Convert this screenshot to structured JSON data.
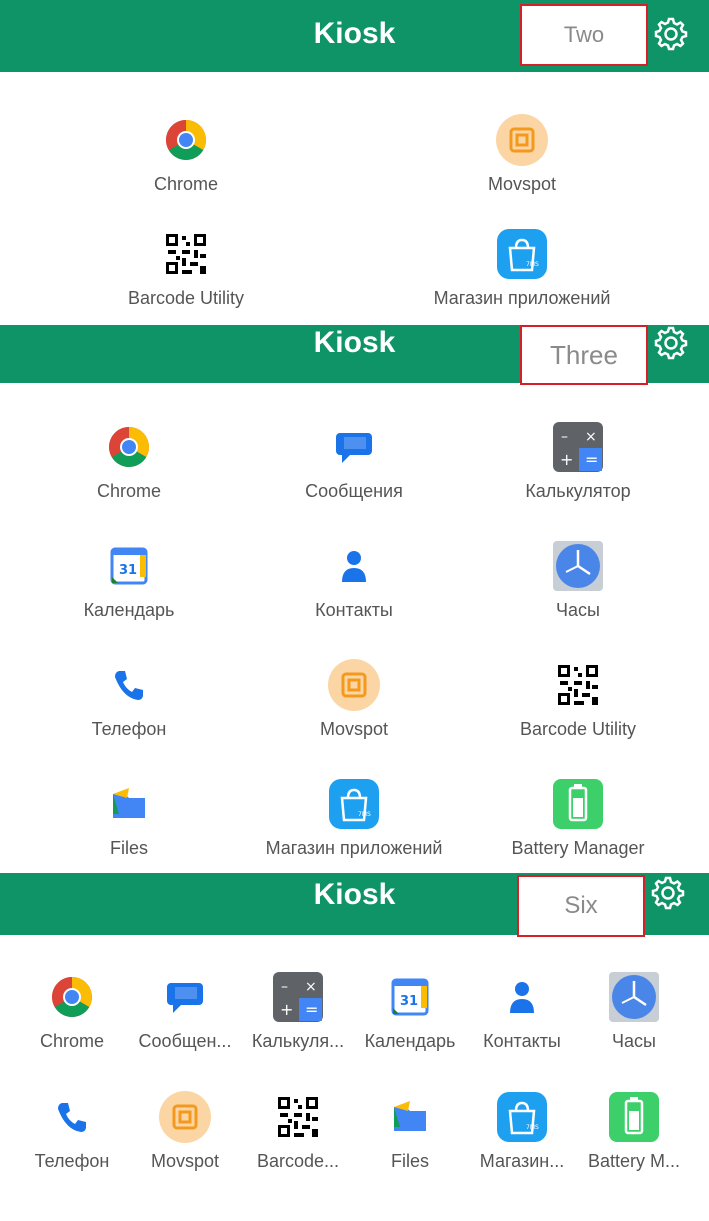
{
  "sections": [
    {
      "title": "Kiosk",
      "mode_label": "Two",
      "apps": [
        {
          "label": "Chrome",
          "icon": "chrome-icon"
        },
        {
          "label": "Movspot",
          "icon": "movspot-icon"
        },
        {
          "label": "Barcode Utility",
          "icon": "qr-code-icon"
        },
        {
          "label": "Магазин приложений",
          "icon": "app-store-icon"
        }
      ]
    },
    {
      "title": "Kiosk",
      "mode_label": "Three",
      "apps": [
        {
          "label": "Chrome",
          "icon": "chrome-icon"
        },
        {
          "label": "Сообщения",
          "icon": "messages-icon"
        },
        {
          "label": "Калькулятор",
          "icon": "calculator-icon"
        },
        {
          "label": "Календарь",
          "icon": "calendar-icon"
        },
        {
          "label": "Контакты",
          "icon": "contacts-icon"
        },
        {
          "label": "Часы",
          "icon": "clock-icon"
        },
        {
          "label": "Телефон",
          "icon": "phone-icon"
        },
        {
          "label": "Movspot",
          "icon": "movspot-icon"
        },
        {
          "label": "Barcode Utility",
          "icon": "qr-code-icon"
        },
        {
          "label": "Files",
          "icon": "files-icon"
        },
        {
          "label": "Магазин приложений",
          "icon": "app-store-icon"
        },
        {
          "label": "Battery Manager",
          "icon": "battery-icon"
        }
      ]
    },
    {
      "title": "Kiosk",
      "mode_label": "Six",
      "apps": [
        {
          "label": "Chrome",
          "icon": "chrome-icon"
        },
        {
          "label": "Сообщен...",
          "icon": "messages-icon"
        },
        {
          "label": "Калькуля...",
          "icon": "calculator-icon"
        },
        {
          "label": "Календарь",
          "icon": "calendar-icon"
        },
        {
          "label": "Контакты",
          "icon": "contacts-icon"
        },
        {
          "label": "Часы",
          "icon": "clock-icon"
        },
        {
          "label": "Телефон",
          "icon": "phone-icon"
        },
        {
          "label": "Movspot",
          "icon": "movspot-icon"
        },
        {
          "label": "Barcode...",
          "icon": "qr-code-icon"
        },
        {
          "label": "Files",
          "icon": "files-icon"
        },
        {
          "label": "Магазин...",
          "icon": "app-store-icon"
        },
        {
          "label": "Battery M...",
          "icon": "battery-icon"
        }
      ]
    }
  ],
  "colors": {
    "header": "#0f9468",
    "label_border": "#d61f26"
  }
}
